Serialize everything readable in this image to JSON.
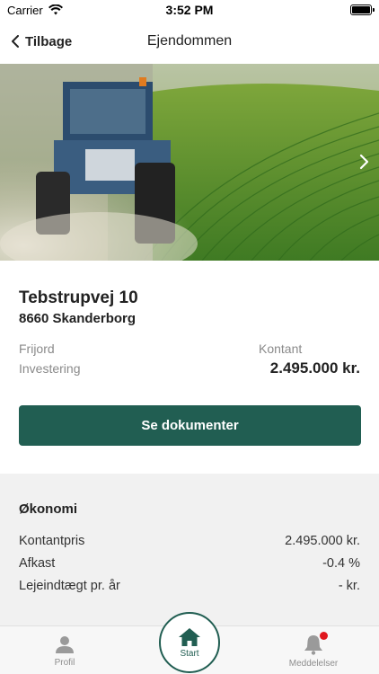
{
  "status_bar": {
    "carrier": "Carrier",
    "time": "3:52 PM"
  },
  "nav": {
    "back_label": "Tilbage",
    "title": "Ejendommen"
  },
  "property": {
    "address": "Tebstrupvej 10",
    "city": "8660 Skanderborg",
    "type_label": "Frijord",
    "category_label": "Investering",
    "payment_label": "Kontant",
    "price": "2.495.000 kr."
  },
  "actions": {
    "documents_label": "Se dokumenter"
  },
  "economy": {
    "title": "Økonomi",
    "rows": [
      {
        "label": "Kontantpris",
        "value": "2.495.000 kr."
      },
      {
        "label": "Afkast",
        "value": "-0.4 %"
      },
      {
        "label": "Lejeindtægt pr. år",
        "value": "- kr."
      }
    ]
  },
  "tabs": {
    "profile": "Profil",
    "start": "Start",
    "notifications": "Meddelelser"
  },
  "colors": {
    "accent": "#215e52",
    "notification_dot": "#e0171e"
  }
}
